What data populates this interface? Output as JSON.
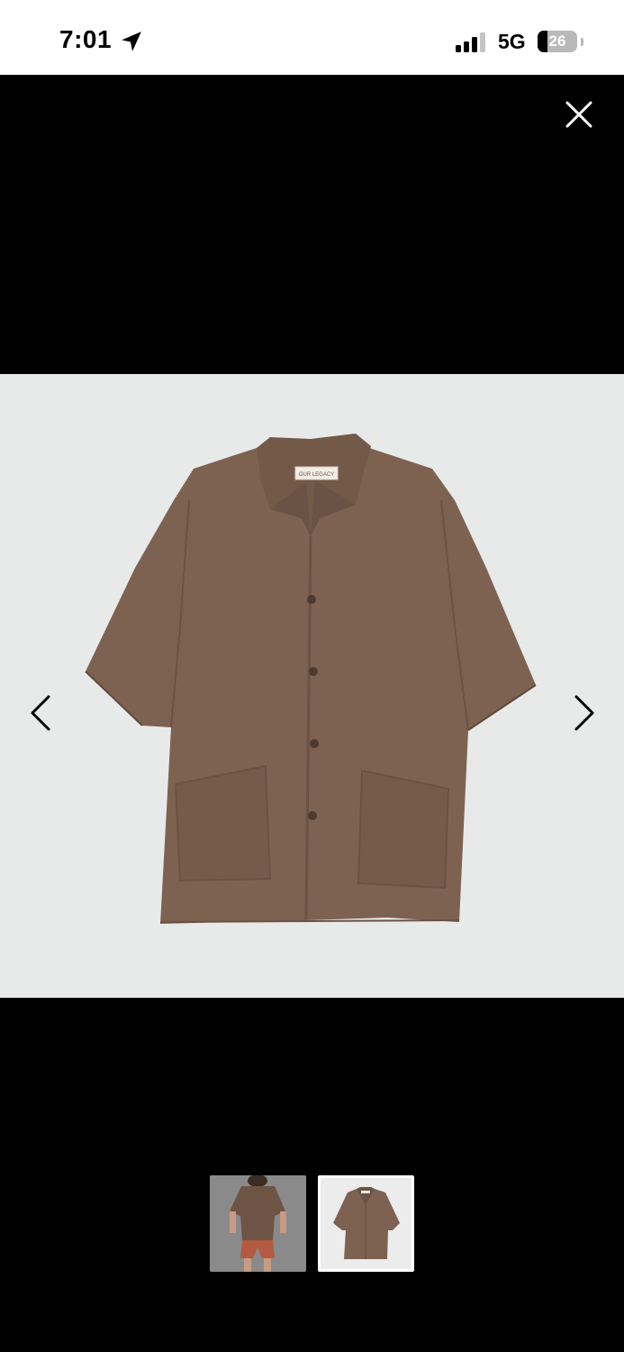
{
  "status_bar": {
    "time": "7:01",
    "location_icon": "location-arrow-icon",
    "signal_icon": "cellular-signal-icon",
    "network": "5G",
    "battery_level": "26",
    "battery_fraction": 0.26
  },
  "viewer": {
    "close_icon": "close-icon",
    "prev_icon": "chevron-left-icon",
    "next_icon": "chevron-right-icon",
    "image": {
      "subject": "short-sleeve-shirt",
      "label_text": "OUR LEGACY"
    },
    "thumbnails": [
      {
        "subject": "model-wearing-shirt",
        "selected": false
      },
      {
        "subject": "shirt-flat",
        "selected": true
      }
    ],
    "colors": {
      "backdrop": "#000000",
      "image_background": "#e8e9e9",
      "shirt": "#7d6252",
      "shirt_shadow": "#6a5244"
    }
  }
}
